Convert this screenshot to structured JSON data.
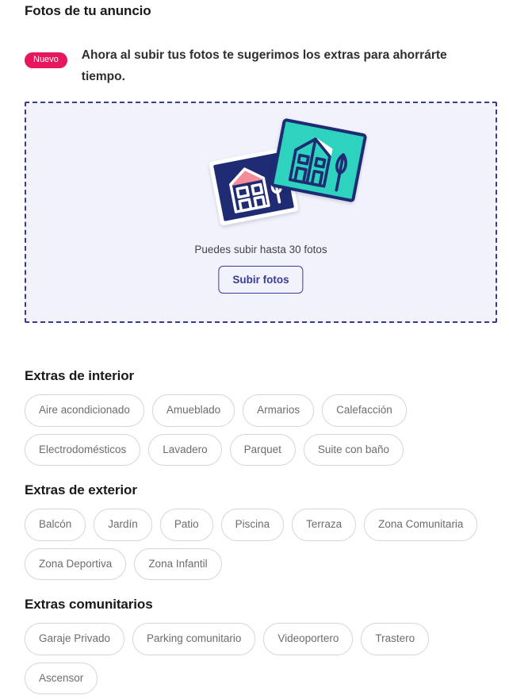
{
  "page_title": "Fotos de tu anuncio",
  "promo": {
    "badge": "Nuevo",
    "text": "Ahora al subir tus fotos te sugerimos los extras para ahorrárte tiempo."
  },
  "dropzone": {
    "hint": "Puedes subir hasta 30 fotos",
    "upload_button": "Subir fotos",
    "illustration": {
      "card_back_name": "photo-card-navy",
      "card_front_name": "photo-card-teal"
    }
  },
  "colors": {
    "badge_pink": "#e6175c",
    "dropzone_border": "#3a3a8c",
    "dropzone_fill": "#f2f2fc",
    "button_indigo": "#3c3c96",
    "card_navy": "#1f2b72",
    "card_teal": "#2ed3c0",
    "roof_pink": "#f48c9a",
    "chip_border": "#d6d6d6",
    "chip_text": "#6c6c72",
    "heading": "#191919"
  },
  "sections": [
    {
      "id": "interior",
      "title": "Extras de interior",
      "chips": [
        "Aire acondicionado",
        "Amueblado",
        "Armarios",
        "Calefacción",
        "Electrodomésticos",
        "Lavadero",
        "Parquet",
        "Suite con baño"
      ]
    },
    {
      "id": "exterior",
      "title": "Extras de exterior",
      "chips": [
        "Balcón",
        "Jardín",
        "Patio",
        "Piscina",
        "Terraza",
        "Zona Comunitaria",
        "Zona Deportiva",
        "Zona Infantil"
      ]
    },
    {
      "id": "comunitario",
      "title": "Extras comunitarios",
      "chips": [
        "Garaje Privado",
        "Parking comunitario",
        "Videoportero",
        "Trastero",
        "Ascensor"
      ]
    }
  ]
}
